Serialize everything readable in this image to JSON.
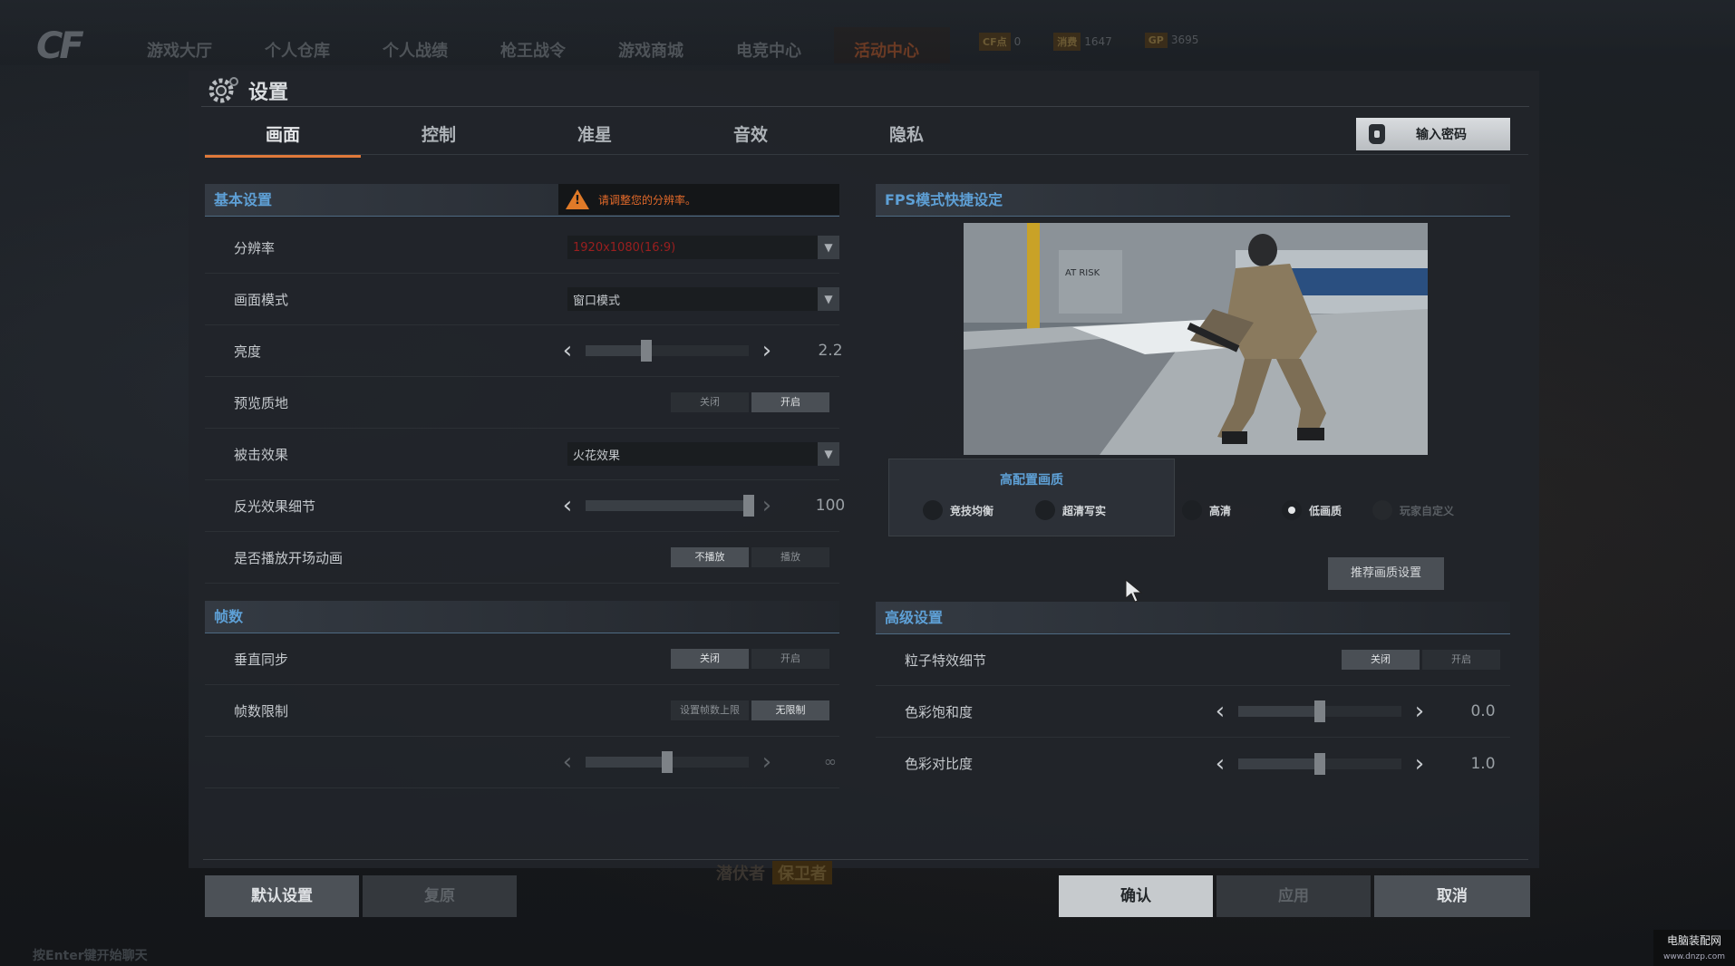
{
  "topbar": {
    "logo": "CF",
    "nav": [
      "游戏大厅",
      "个人仓库",
      "个人战绩",
      "枪王战令",
      "游戏商城",
      "电竞中心",
      "活动中心"
    ],
    "stats": [
      {
        "badge": "CF点",
        "value": "0"
      },
      {
        "badge": "消费",
        "value": "1647"
      },
      {
        "badge": "GP",
        "value": "3695"
      }
    ]
  },
  "settings": {
    "title": "设置",
    "tabs": [
      "画面",
      "控制",
      "准星",
      "音效",
      "隐私"
    ],
    "password_button": "输入密码",
    "basic": {
      "header": "基本设置",
      "warning": "请调整您的分辨率。",
      "resolution": {
        "label": "分辨率",
        "value": "1920x1080(16:9)"
      },
      "display_mode": {
        "label": "画面模式",
        "value": "窗口模式"
      },
      "brightness": {
        "label": "亮度",
        "value": "2.2",
        "level": 0.37
      },
      "preview_texture": {
        "label": "预览质地",
        "off": "关闭",
        "on": "开启",
        "selected": "on"
      },
      "hit_effect": {
        "label": "被击效果",
        "value": "火花效果"
      },
      "reflection_detail": {
        "label": "反光效果细节",
        "value": "100",
        "level": 1.0
      },
      "intro_anim": {
        "label": "是否播放开场动画",
        "off": "不播放",
        "on": "播放",
        "selected": "off"
      }
    },
    "fps_section": {
      "header": "帧数",
      "vsync": {
        "label": "垂直同步",
        "off": "关闭",
        "on": "开启",
        "selected": "off"
      },
      "fps_limit": {
        "label": "帧数限制",
        "set": "设置帧数上限",
        "unlimited": "无限制",
        "selected": "unlimited"
      },
      "fps_slider": {
        "value": "∞",
        "level": 0.5
      }
    },
    "fps_mode": {
      "header": "FPS模式快捷设定",
      "preset_header": "高配置画质",
      "presets": [
        {
          "label": "竞技均衡",
          "selected": false,
          "enabled": true
        },
        {
          "label": "超清写实",
          "selected": false,
          "enabled": true
        },
        {
          "label": "高清",
          "selected": false,
          "enabled": true
        },
        {
          "label": "低画质",
          "selected": true,
          "enabled": true
        },
        {
          "label": "玩家自定义",
          "selected": false,
          "enabled": false
        }
      ],
      "recommend_button": "推荐画质设置",
      "preview_sign": "AT RISK"
    },
    "advanced": {
      "header": "高级设置",
      "particle_detail": {
        "label": "粒子特效细节",
        "off": "关闭",
        "on": "开启",
        "selected": "off"
      },
      "saturation": {
        "label": "色彩饱和度",
        "value": "0.0",
        "level": 0.5
      },
      "contrast": {
        "label": "色彩对比度",
        "value": "1.0",
        "level": 0.5
      }
    },
    "buttons": {
      "default": "默认设置",
      "restore": "复原",
      "confirm": "确认",
      "apply": "应用",
      "cancel": "取消"
    }
  },
  "background": {
    "bottom_hint": "按Enter键开始聊天",
    "tags": [
      "潜伏者",
      "保卫者"
    ]
  },
  "watermark": {
    "line1": "电脑装配网",
    "line2": "www.dnzp.com"
  },
  "colors": {
    "accent_blue": "#5ea0d6",
    "accent_orange": "#e0793a",
    "warning": "#e36a2a"
  }
}
